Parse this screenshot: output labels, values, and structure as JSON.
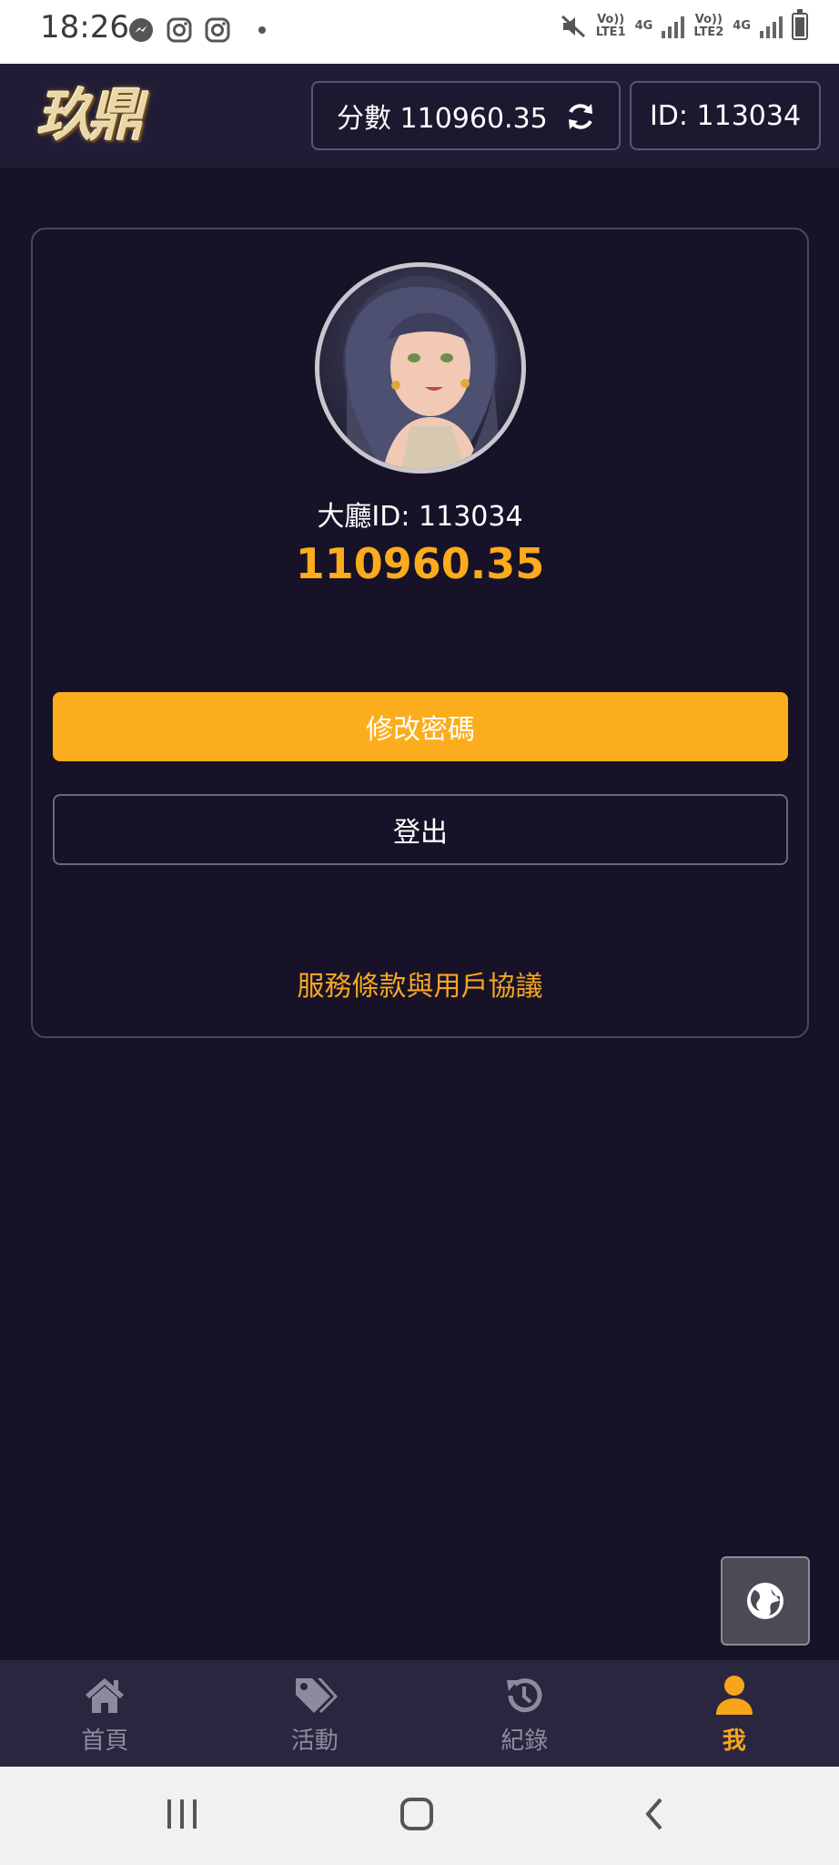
{
  "status_bar": {
    "time": "18:26",
    "sim1_label": "Vo))\nLTE1",
    "sim1_net": "4G",
    "sim2_label": "Vo))\nLTE2",
    "sim2_net": "4G"
  },
  "header": {
    "logo_text": "玖鼎",
    "score_label": "分數 110960.35",
    "id_label": "ID: 113034"
  },
  "profile": {
    "lobby_id": "大廳ID: 113034",
    "balance": "110960.35",
    "change_password_label": "修改密碼",
    "logout_label": "登出",
    "terms_link": "服務條款與用戶協議"
  },
  "bottom_nav": {
    "items": [
      {
        "label": "首頁",
        "icon": "home-icon"
      },
      {
        "label": "活動",
        "icon": "tag-icon"
      },
      {
        "label": "紀錄",
        "icon": "history-icon"
      },
      {
        "label": "我",
        "icon": "user-icon"
      }
    ],
    "active_index": 3
  },
  "colors": {
    "background": "#171227",
    "accent": "#fbad1d",
    "header": "#211c35",
    "nav": "#2b2640"
  }
}
